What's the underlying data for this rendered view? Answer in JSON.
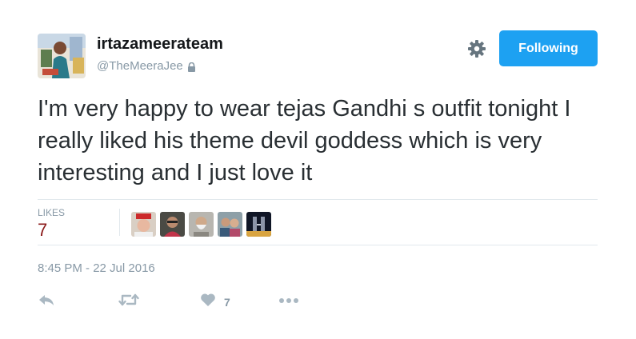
{
  "user": {
    "display_name": "irtazameerateam",
    "handle": "@TheMeeraJee",
    "protected": true
  },
  "header": {
    "follow_label": "Following",
    "icons": [
      "gear-icon",
      "lock-icon"
    ]
  },
  "tweet": {
    "text": "I'm very happy to wear tejas Gandhi s outfit tonight I really liked his theme devil goddess which is very interesting and I just love it",
    "timestamp": "8:45 PM - 22 Jul 2016"
  },
  "stats": {
    "likes_label": "LIKES",
    "likes_count": "7",
    "liker_avatars": 5
  },
  "actions": {
    "like_count": "7",
    "icons": [
      "reply-icon",
      "retweet-icon",
      "heart-icon",
      "more-icon"
    ]
  },
  "colors": {
    "accent": "#1da1f2",
    "muted": "#8899a6",
    "text": "#292f33",
    "likes_count": "#8b1a1a",
    "icon": "#aab8c2"
  }
}
